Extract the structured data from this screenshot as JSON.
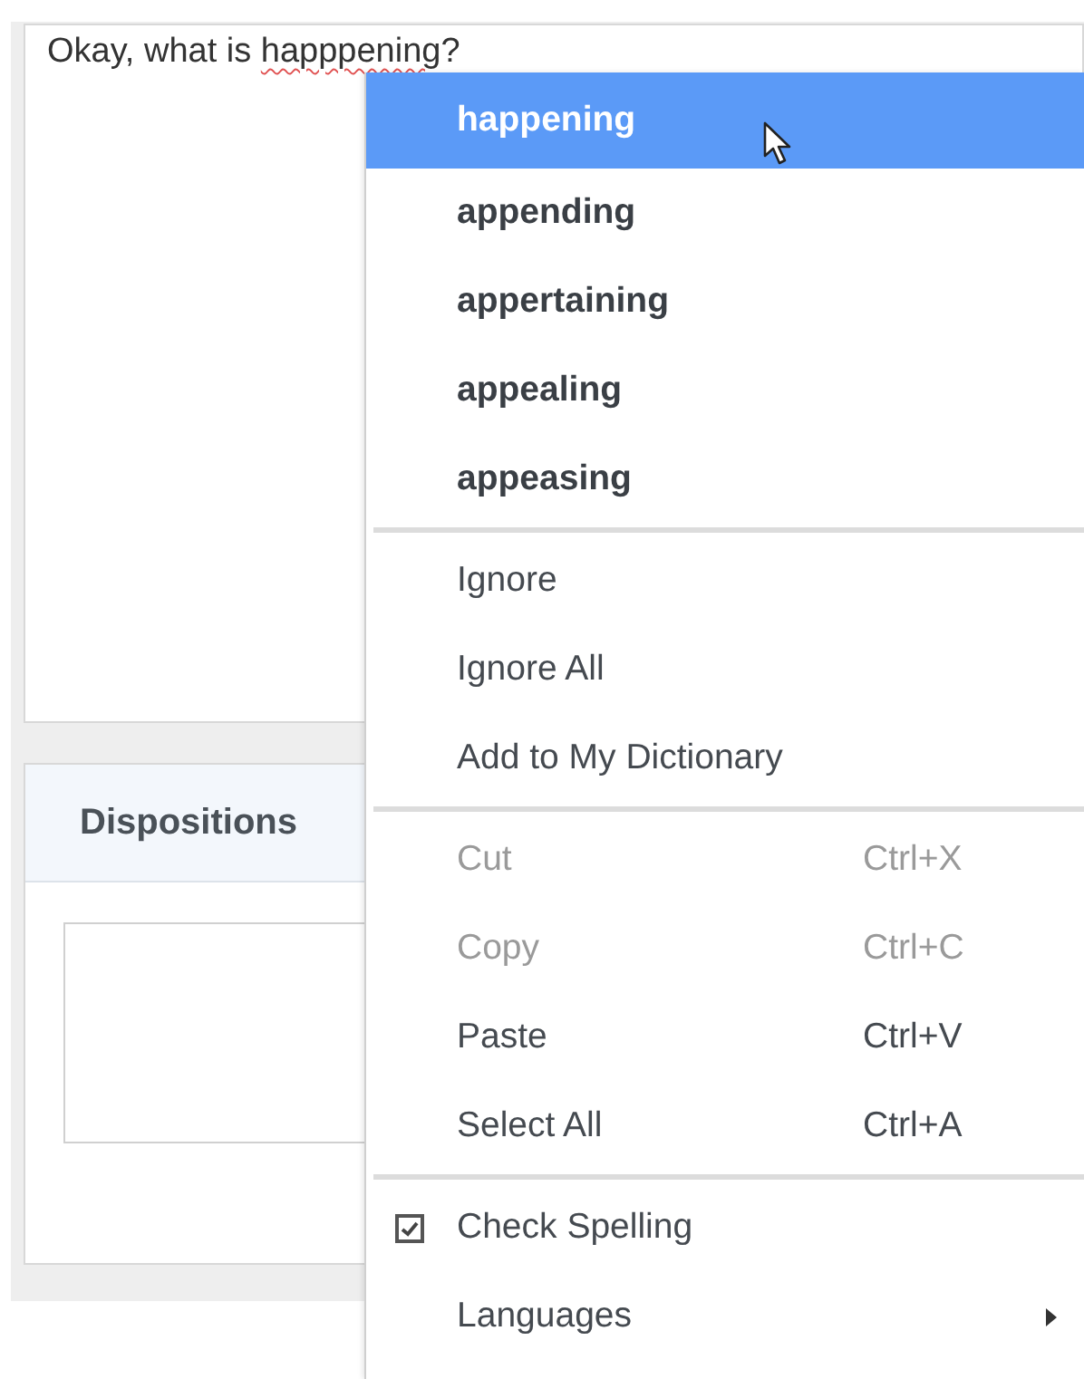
{
  "message_field": {
    "text_before": "Okay, what is ",
    "misspelled_word": "happpening",
    "text_after": "?"
  },
  "dispositions_panel": {
    "title": "Dispositions"
  },
  "context_menu": {
    "groups": [
      [
        {
          "kind": "suggestion",
          "label": "happening",
          "selected": true
        },
        {
          "kind": "suggestion",
          "label": "appending",
          "selected": false
        },
        {
          "kind": "suggestion",
          "label": "appertaining",
          "selected": false
        },
        {
          "kind": "suggestion",
          "label": "appealing",
          "selected": false
        },
        {
          "kind": "suggestion",
          "label": "appeasing",
          "selected": false
        }
      ],
      [
        {
          "kind": "action",
          "label": "Ignore",
          "disabled": false
        },
        {
          "kind": "action",
          "label": "Ignore All",
          "disabled": false
        },
        {
          "kind": "action",
          "label": "Add to My Dictionary",
          "disabled": false
        }
      ],
      [
        {
          "kind": "action",
          "label": "Cut",
          "shortcut": "Ctrl+X",
          "disabled": true
        },
        {
          "kind": "action",
          "label": "Copy",
          "shortcut": "Ctrl+C",
          "disabled": true
        },
        {
          "kind": "action",
          "label": "Paste",
          "shortcut": "Ctrl+V",
          "disabled": false
        },
        {
          "kind": "action",
          "label": "Select All",
          "shortcut": "Ctrl+A",
          "disabled": false
        }
      ],
      [
        {
          "kind": "check",
          "label": "Check Spelling",
          "checked": true
        },
        {
          "kind": "submenu",
          "label": "Languages"
        }
      ]
    ]
  }
}
